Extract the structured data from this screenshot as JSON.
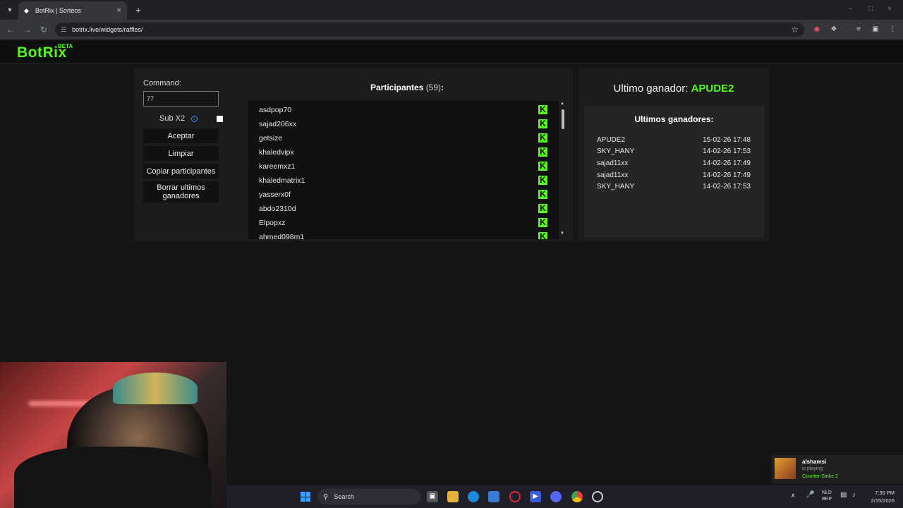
{
  "browser": {
    "tab_title": "BotRix | Sorteos",
    "tab_favicon": "botrix-favicon",
    "url": "botrix.live/widgets/raffles/"
  },
  "site": {
    "logo": "BotRix",
    "logo_badge": "BETA",
    "accent_color": "#53fc18"
  },
  "controls": {
    "command_label": "Command:",
    "command_value": "77",
    "sub_label": "Sub X2",
    "sub_checked": false,
    "buttons": [
      "Aceptar",
      "Limpiar",
      "Copiar participantes",
      "Borrar ultimos ganadores"
    ]
  },
  "participants": {
    "title": "Participantes",
    "count": "(59)",
    "suffix": ":",
    "list": [
      "asdpop70",
      "sajad206xx",
      "getsize",
      "khaledvipx",
      "kareemxz1",
      "khaledmatrix1",
      "yasserx0f",
      "abdo2310d",
      "Elpopxz",
      "ahmed098m1"
    ],
    "platform_icon": "kick-icon"
  },
  "winner": {
    "label": "Ultimo ganador:",
    "name": "APUDE2",
    "history_title": "Ultimos ganadores:",
    "history": [
      {
        "name": "APUDE2",
        "date": "15-02-26 17:48"
      },
      {
        "name": "SKY_HANY",
        "date": "14-02-26 17:53"
      },
      {
        "name": "sajad11xx",
        "date": "14-02-26 17:49"
      },
      {
        "name": "sajad11xx",
        "date": "14-02-26 17:49"
      },
      {
        "name": "SKY_HANY",
        "date": "14-02-26 17:53"
      }
    ]
  },
  "notification": {
    "name": "alshamsi",
    "status": "is playing",
    "game": "Counter-Strike 2"
  },
  "taskbar": {
    "search_label": "Search",
    "lang": "NLD",
    "lang2": "BEP",
    "time": "7:35 PM",
    "date": "2/15/2026"
  }
}
